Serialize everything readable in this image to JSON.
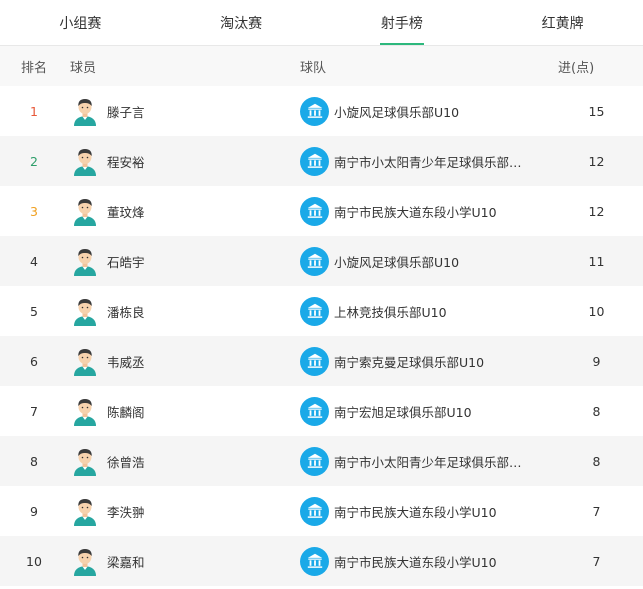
{
  "tabs": [
    {
      "label": "小组赛",
      "active": false
    },
    {
      "label": "淘汰赛",
      "active": false
    },
    {
      "label": "射手榜",
      "active": true
    },
    {
      "label": "红黄牌",
      "active": false
    }
  ],
  "table": {
    "headers": {
      "rank": "排名",
      "player": "球员",
      "team": "球队",
      "goals": "进(点)"
    },
    "rows": [
      {
        "rank": "1",
        "player": "滕子言",
        "team": "小旋风足球俱乐部U10",
        "goals": "15"
      },
      {
        "rank": "2",
        "player": "程安裕",
        "team": "南宁市小太阳青少年足球俱乐部U...",
        "goals": "12"
      },
      {
        "rank": "3",
        "player": "董玟烽",
        "team": "南宁市民族大道东段小学U10",
        "goals": "12"
      },
      {
        "rank": "4",
        "player": "石皓宇",
        "team": "小旋风足球俱乐部U10",
        "goals": "11"
      },
      {
        "rank": "5",
        "player": "潘栋良",
        "team": "上林竞技俱乐部U10",
        "goals": "10"
      },
      {
        "rank": "6",
        "player": "韦威丞",
        "team": "南宁索克曼足球俱乐部U10",
        "goals": "9"
      },
      {
        "rank": "7",
        "player": "陈麟阁",
        "team": "南宁宏旭足球俱乐部U10",
        "goals": "8"
      },
      {
        "rank": "8",
        "player": "徐曾浩",
        "team": "南宁市小太阳青少年足球俱乐部U...",
        "goals": "8"
      },
      {
        "rank": "9",
        "player": "李泆翀",
        "team": "南宁市民族大道东段小学U10",
        "goals": "7"
      },
      {
        "rank": "10",
        "player": "梁嘉和",
        "team": "南宁市民族大道东段小学U10",
        "goals": "7"
      }
    ]
  },
  "icons": {
    "avatar": "player-avatar-icon",
    "team_logo": "bank-building-icon"
  },
  "colors": {
    "accent": "#2db87d",
    "team_logo_bg": "#1aa9e8",
    "rank1": "#e8593a",
    "rank2": "#2e9e6a",
    "rank3": "#f0a020"
  }
}
